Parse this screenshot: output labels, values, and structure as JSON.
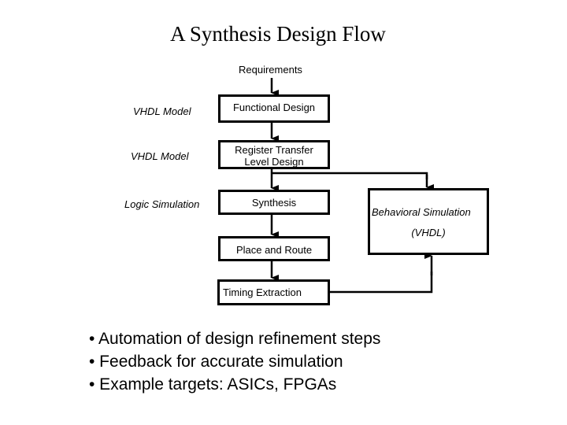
{
  "title": "A Synthesis Design Flow",
  "flow": {
    "start_label": "Requirements",
    "steps": [
      {
        "label": "Functional Design",
        "side_label": "VHDL Model"
      },
      {
        "label_line1": "Register Transfer",
        "label_line2": "Level Design",
        "side_label": "VHDL Model"
      },
      {
        "label": "Synthesis",
        "side_label": "Logic Simulation"
      },
      {
        "label": "Place and Route"
      },
      {
        "label": "Timing Extraction"
      }
    ],
    "feedback_box": {
      "line1": "Behavioral Simulation",
      "line2": "(VHDL)"
    }
  },
  "bullets": [
    "• Automation of design refinement steps",
    "• Feedback for accurate simulation",
    "• Example targets: ASICs, FPGAs"
  ]
}
